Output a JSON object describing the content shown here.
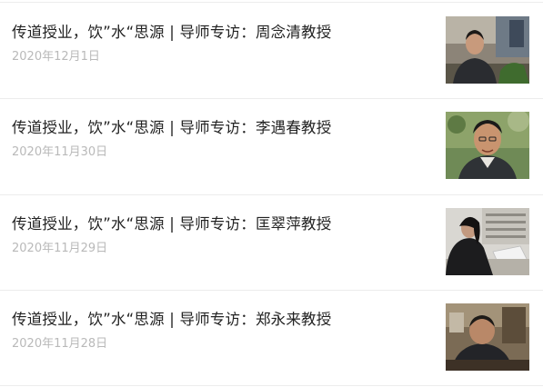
{
  "articles": [
    {
      "title": "传道授业，饮”水“思源 | 导师专访：周念清教授",
      "date": "2020年12月1日",
      "thumbnail_icon": "portrait-photo"
    },
    {
      "title": "传道授业，饮”水“思源 | 导师专访：李遇春教授",
      "date": "2020年11月30日",
      "thumbnail_icon": "portrait-photo"
    },
    {
      "title": "传道授业，饮”水“思源 | 导师专访：匡翠萍教授",
      "date": "2020年11月29日",
      "thumbnail_icon": "portrait-photo"
    },
    {
      "title": "传道授业，饮”水“思源 | 导师专访：郑永来教授",
      "date": "2020年11月28日",
      "thumbnail_icon": "portrait-photo"
    }
  ]
}
